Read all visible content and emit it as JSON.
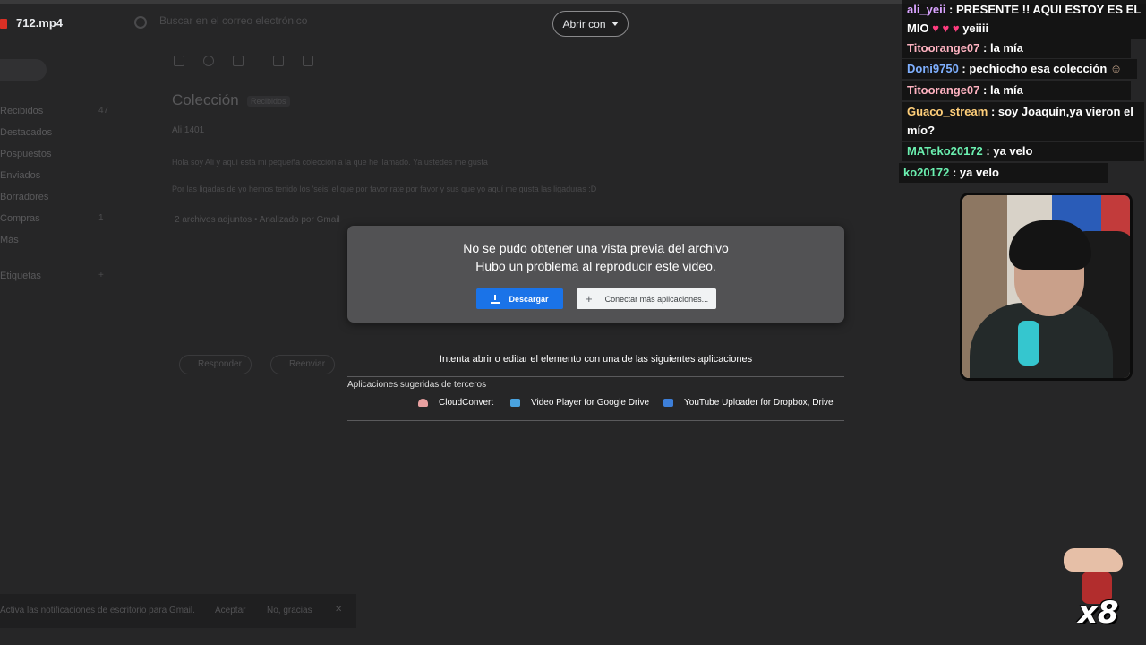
{
  "viewer": {
    "file_name": "712.mp4",
    "open_with_label": "Abrir con",
    "preview_error_line1": "No se pudo obtener una vista previa del archivo",
    "preview_error_line2": "Hubo un problema al reproducir este video.",
    "download_label": "Descargar",
    "connect_label": "Conectar más aplicaciones...",
    "try_open_text": "Intenta abrir o editar el elemento con una de las siguientes aplicaciones",
    "third_party_label": "Aplicaciones sugeridas de terceros",
    "apps": [
      {
        "name": "CloudConvert",
        "icon": "cloud-icon"
      },
      {
        "name": "Video Player for Google Drive",
        "icon": "video-player-icon"
      },
      {
        "name": "YouTube Uploader for Dropbox, Drive",
        "icon": "upload-icon"
      }
    ]
  },
  "gmail_background": {
    "search_placeholder": "Buscar en el correo electrónico",
    "mail_title": "Colección",
    "mail_tag": "Recibidos",
    "mail_from": "Ali 1401",
    "body_line1": "Hola soy Ali y aquí está mi pequeña colección a la que he llamado. Ya ustedes me gusta",
    "body_line2": "Por las ligadas de yo hemos tenido los 'seis' el que por favor rate por favor y sus que yo aquí me gusta las ligaduras :D",
    "attachments_label": "2 archivos adjuntos • Analizado por Gmail",
    "reply_label": "Responder",
    "forward_label": "Reenviar",
    "snackbar_text": "Activa las notificaciones de escritorio para Gmail.",
    "snackbar_accept": "Aceptar",
    "snackbar_dismiss": "No, gracias",
    "sidebar": [
      {
        "label": "Recibidos",
        "count": "47"
      },
      {
        "label": "Destacados",
        "count": ""
      },
      {
        "label": "Pospuestos",
        "count": ""
      },
      {
        "label": "Enviados",
        "count": ""
      },
      {
        "label": "Borradores",
        "count": ""
      },
      {
        "label": "Compras",
        "count": "1"
      },
      {
        "label": "Más",
        "count": ""
      },
      {
        "label": "Etiquetas",
        "count": "+"
      }
    ]
  },
  "chat": [
    {
      "user": "ali_yeii",
      "user_color": "#d9a3ff",
      "text": "PRESENTE !! AQUI ESTOY ES EL MIO",
      "trail": "yeiiii"
    },
    {
      "user": "Titoorange07",
      "user_color": "#ffb3c1",
      "text": "la mía"
    },
    {
      "user": "Doni9750",
      "user_color": "#7fb0ff",
      "text": "pechiocho esa colección"
    },
    {
      "user": "Titoorange07",
      "user_color": "#ffb3c1",
      "text": "la mía"
    },
    {
      "user": "Guaco_stream",
      "user_color": "#ffcf7a",
      "text": "soy Joaquín,ya vieron el mío?"
    },
    {
      "user": "MATeko20172",
      "user_color": "#6bf0b0",
      "text": "ya velo"
    },
    {
      "user": "ko20172",
      "user_color": "#6bf0b0",
      "text": "ya velo"
    }
  ],
  "emote": {
    "multiplier": "x8"
  },
  "colors": {
    "accent_blue": "#1a73e8",
    "card_bg": "#525254",
    "page_bg": "#2b2b2c"
  }
}
